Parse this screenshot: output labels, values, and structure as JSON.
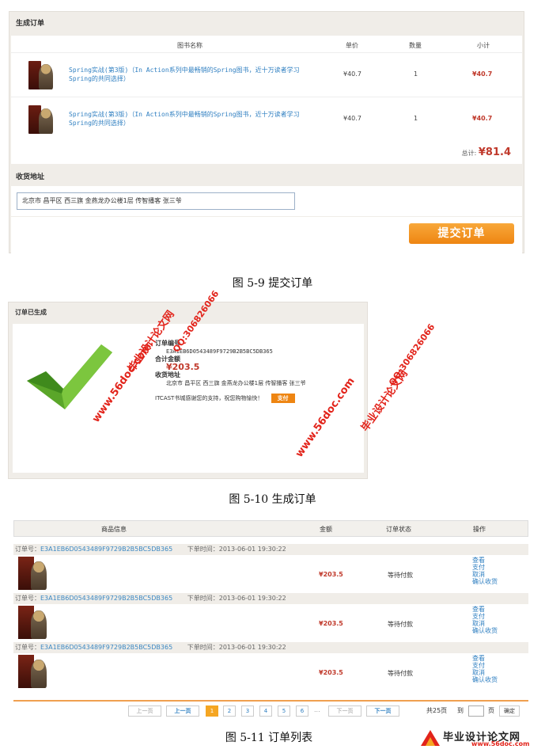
{
  "fig1": {
    "panel_title": "生成订单",
    "headers": {
      "name": "图书名称",
      "price": "单价",
      "qty": "数量",
      "subtotal": "小计"
    },
    "rows": [
      {
        "title": "Spring实战(第3版)（In Action系列中最畅销的Spring图书，近十万读者学习Spring的共同选择）",
        "price": "¥40.7",
        "qty": "1",
        "subtotal": "¥40.7"
      },
      {
        "title": "Spring实战(第3版)（In Action系列中最畅销的Spring图书，近十万读者学习Spring的共同选择）",
        "price": "¥40.7",
        "qty": "1",
        "subtotal": "¥40.7"
      }
    ],
    "total_label": "总计:",
    "total_value": "¥81.4",
    "address_title": "收货地址",
    "address_value": "北京市 昌平区 西三旗 金燕龙办公楼1层 传智播客 张三爷",
    "submit_label": "提交订单",
    "caption": "图  5-9  提交订单"
  },
  "fig2": {
    "panel_title": "订单已生成",
    "order_no_label": "订单编号",
    "order_no": "E3A1EB6D0543489F9729B2B5BC5DB365",
    "amount_label": "合计金额",
    "amount": "¥203.5",
    "address_label": "收货地址",
    "address": "北京市 昌平区 西三旗 金燕龙办公楼1层 传智播客 张三爷",
    "thanks": "ITCAST书城感谢您的支持，祝您购物愉快！",
    "pay_label": "支付",
    "caption": "图  5-10  生成订单",
    "watermarks": {
      "site": "www.56doc.com",
      "qq": "QQ:306826066",
      "name": "毕业设计论文网"
    }
  },
  "fig3": {
    "headers": {
      "info": "商品信息",
      "amount": "金额",
      "status": "订单状态",
      "action": "操作"
    },
    "orders": [
      {
        "no_label": "订单号：",
        "no": "E3A1EB6D0543489F9729B2B5BC5DB365",
        "time": "下单时间：2013-06-01 19:30:22",
        "amount": "¥203.5",
        "status": "等待付款",
        "acts": [
          "查看",
          "支付",
          "取消",
          "确认收货"
        ]
      },
      {
        "no_label": "订单号：",
        "no": "E3A1EB6D0543489F9729B2B5BC5DB365",
        "time": "下单时间：2013-06-01 19:30:22",
        "amount": "¥203.5",
        "status": "等待付款",
        "acts": [
          "查看",
          "支付",
          "取消",
          "确认收货"
        ]
      },
      {
        "no_label": "订单号：",
        "no": "E3A1EB6D0543489F9729B2B5BC5DB365",
        "time": "下单时间：2013-06-01 19:30:22",
        "amount": "¥203.5",
        "status": "等待付款",
        "acts": [
          "查看",
          "支付",
          "取消",
          "确认收货"
        ]
      }
    ],
    "pager": {
      "first": "上一页",
      "prev": "上一页",
      "pages": [
        "1",
        "2",
        "3",
        "4",
        "5",
        "6"
      ],
      "current": "1",
      "ellipsis": "...",
      "next_gray": "下一页",
      "next": "下一页",
      "total": "共25页",
      "goto": "到",
      "page_unit": "页",
      "confirm": "确定"
    },
    "caption": "图  5-11  订单列表"
  },
  "logo": {
    "cn": "毕业设计论文网",
    "url": "www.56doc.com"
  }
}
